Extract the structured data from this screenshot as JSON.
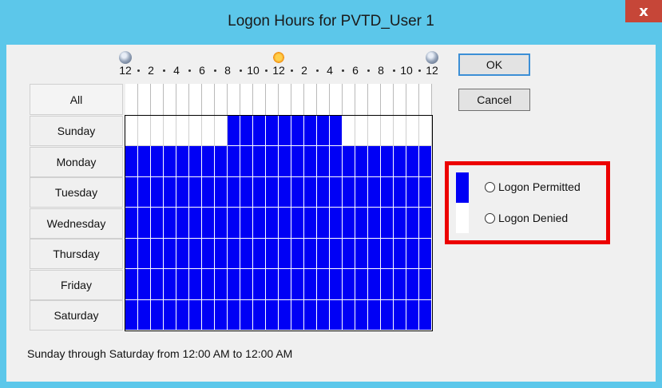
{
  "window": {
    "title": "Logon Hours for PVTD_User 1",
    "close_label": "x"
  },
  "timeline": {
    "labels": [
      "12",
      "2",
      "4",
      "6",
      "8",
      "10",
      "12",
      "2",
      "4",
      "6",
      "8",
      "10",
      "12"
    ],
    "icons": [
      "moon-icon",
      "sun-icon",
      "moon-icon"
    ]
  },
  "days": {
    "all": "All",
    "rows": [
      "Sunday",
      "Monday",
      "Tuesday",
      "Wednesday",
      "Thursday",
      "Friday",
      "Saturday"
    ]
  },
  "schedule": {
    "hours_per_day": 24,
    "permitted_hours": [
      [
        8,
        9,
        10,
        11,
        12,
        13,
        14,
        15,
        16
      ],
      [
        0,
        1,
        2,
        3,
        4,
        5,
        6,
        7,
        8,
        9,
        10,
        11,
        12,
        13,
        14,
        15,
        16,
        17,
        18,
        19,
        20,
        21,
        22,
        23
      ],
      [
        0,
        1,
        2,
        3,
        4,
        5,
        6,
        7,
        8,
        9,
        10,
        11,
        12,
        13,
        14,
        15,
        16,
        17,
        18,
        19,
        20,
        21,
        22,
        23
      ],
      [
        0,
        1,
        2,
        3,
        4,
        5,
        6,
        7,
        8,
        9,
        10,
        11,
        12,
        13,
        14,
        15,
        16,
        17,
        18,
        19,
        20,
        21,
        22,
        23
      ],
      [
        0,
        1,
        2,
        3,
        4,
        5,
        6,
        7,
        8,
        9,
        10,
        11,
        12,
        13,
        14,
        15,
        16,
        17,
        18,
        19,
        20,
        21,
        22,
        23
      ],
      [
        0,
        1,
        2,
        3,
        4,
        5,
        6,
        7,
        8,
        9,
        10,
        11,
        12,
        13,
        14,
        15,
        16,
        17,
        18,
        19,
        20,
        21,
        22,
        23
      ],
      [
        0,
        1,
        2,
        3,
        4,
        5,
        6,
        7,
        8,
        9,
        10,
        11,
        12,
        13,
        14,
        15,
        16,
        17,
        18,
        19,
        20,
        21,
        22,
        23
      ]
    ]
  },
  "buttons": {
    "ok": "OK",
    "cancel": "Cancel"
  },
  "legend": {
    "permitted": "Logon Permitted",
    "denied": "Logon Denied"
  },
  "status": "Sunday through Saturday from 12:00 AM to 12:00 AM",
  "colors": {
    "permitted": "#0000f5",
    "denied": "#ffffff",
    "highlight": "#ec0000"
  }
}
